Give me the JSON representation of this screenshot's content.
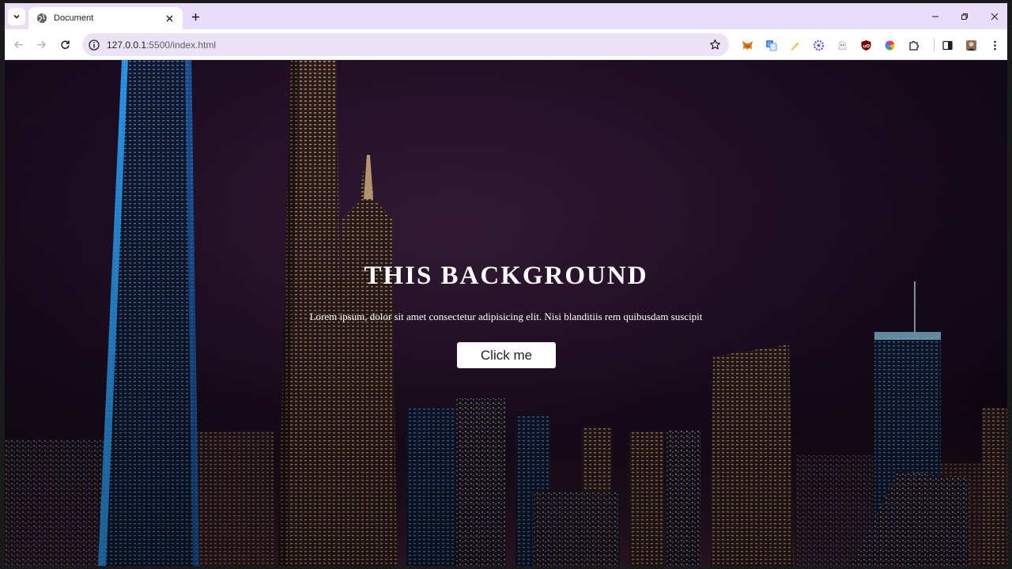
{
  "browser": {
    "tab": {
      "title": "Document",
      "favicon": "globe-icon"
    },
    "address": {
      "host": "127.0.0.1",
      "rest": ":5500/index.html"
    },
    "extensions": [
      "metamask-icon",
      "translate-icon",
      "highlighter-icon",
      "gear-flower-icon",
      "ghost-icon",
      "ublock-icon",
      "color-wheel-icon",
      "puzzle-icon"
    ],
    "colors": {
      "tabstrip": "#e9dcfb",
      "omnibox": "#ebe3f5"
    }
  },
  "page": {
    "title": "THIS BACKGROUND",
    "text": "Lorem ipsum, dolor sit amet consectetur adipisicing elit. Nisi blanditiis rem quibusdam suscipit",
    "button_label": "Click me",
    "background": "night-city-skyline-image"
  }
}
